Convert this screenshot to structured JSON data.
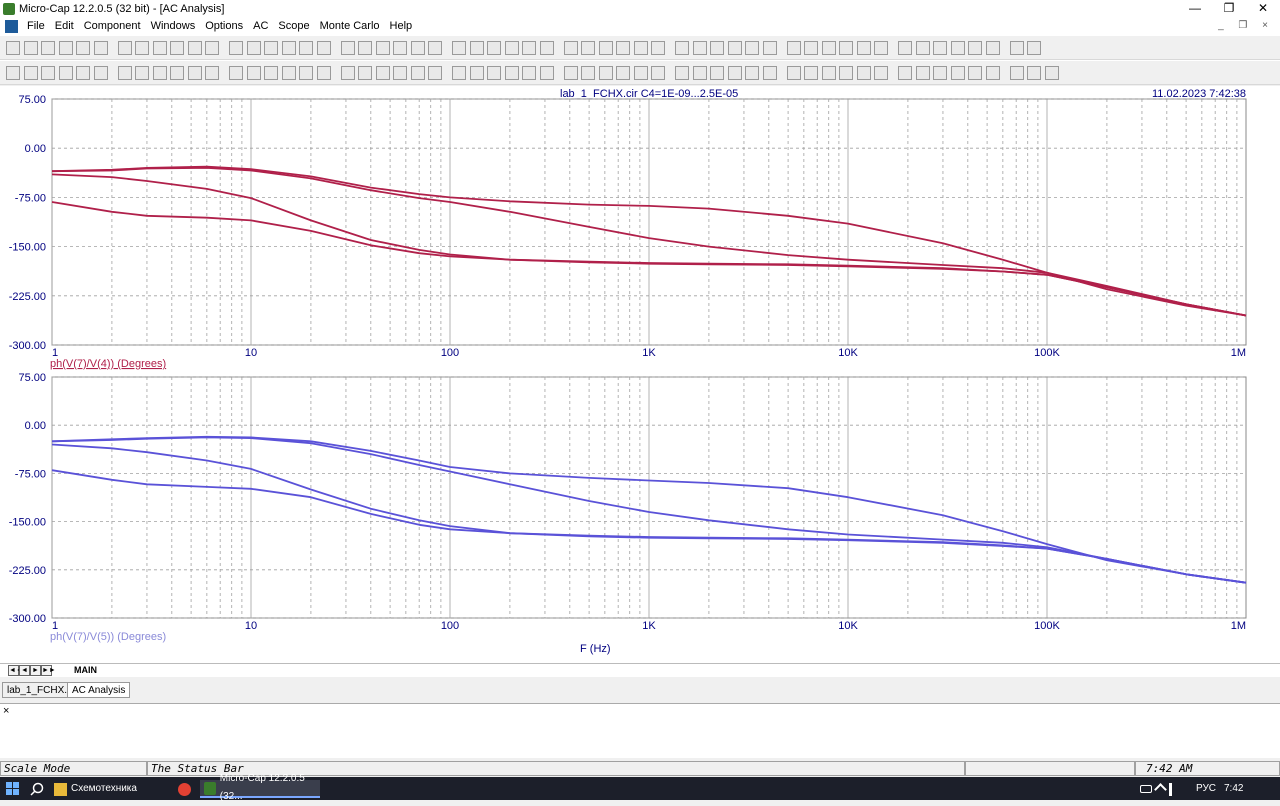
{
  "window": {
    "title": "Micro-Cap 12.2.0.5 (32 bit) - [AC Analysis]"
  },
  "menu": [
    "File",
    "Edit",
    "Component",
    "Windows",
    "Options",
    "AC",
    "Scope",
    "Monte Carlo",
    "Help"
  ],
  "plot": {
    "header": "lab_1_FCHX.cir C4=1E-09...2.5E-05",
    "timestamp": "11.02.2023 7:42:38",
    "x_label": "F (Hz)",
    "x_ticks": [
      "1",
      "10",
      "100",
      "1K",
      "10K",
      "100K",
      "1M"
    ],
    "y_ticks": [
      "75.00",
      "0.00",
      "-75.00",
      "-150.00",
      "-225.00",
      "-300.00"
    ],
    "colors": {
      "top": "#b0204a",
      "bottom": "#5a52d8",
      "grid": "#a0a0a0",
      "axis_text": "#000080"
    }
  },
  "chart_data": [
    {
      "type": "line",
      "scale_x": "log",
      "xlim": [
        1,
        1000000
      ],
      "ylim": [
        -300,
        75
      ],
      "ylabel": "ph(V(7)/V(4)) (Degrees)",
      "xlabel": "F (Hz)",
      "series": [
        {
          "x": [
            1,
            2,
            3,
            6,
            10,
            20,
            40,
            70,
            100,
            200,
            500,
            1000,
            2000,
            5000,
            10000,
            30000,
            60000,
            100000,
            200000,
            500000,
            1000000
          ],
          "values": [
            -35,
            -33,
            -30,
            -28,
            -32,
            -43,
            -60,
            -70,
            -75,
            -81,
            -86,
            -88,
            -92,
            -103,
            -115,
            -145,
            -170,
            -190,
            -215,
            -240,
            -255
          ]
        },
        {
          "x": [
            1,
            2,
            3,
            6,
            10,
            20,
            40,
            70,
            100,
            200,
            500,
            1000,
            2000,
            5000,
            10000,
            30000,
            60000,
            100000,
            200000,
            500000,
            1000000
          ],
          "values": [
            -35,
            -34,
            -31,
            -30,
            -34,
            -46,
            -64,
            -76,
            -82,
            -97,
            -120,
            -137,
            -150,
            -163,
            -170,
            -178,
            -183,
            -190,
            -210,
            -238,
            -255
          ]
        },
        {
          "x": [
            1,
            2,
            3,
            6,
            10,
            20,
            40,
            70,
            100,
            200,
            500,
            1000,
            2000,
            5000,
            10000,
            30000,
            60000,
            100000,
            200000,
            500000,
            1000000
          ],
          "values": [
            -40,
            -44,
            -50,
            -62,
            -76,
            -110,
            -140,
            -155,
            -162,
            -170,
            -174,
            -176,
            -177,
            -178,
            -180,
            -184,
            -188,
            -193,
            -212,
            -238,
            -255
          ]
        },
        {
          "x": [
            1,
            2,
            3,
            6,
            10,
            20,
            40,
            70,
            100,
            200,
            500,
            1000,
            2000,
            5000,
            10000,
            30000,
            60000,
            100000,
            200000,
            500000,
            1000000
          ],
          "values": [
            -82,
            -97,
            -103,
            -106,
            -110,
            -126,
            -148,
            -160,
            -165,
            -170,
            -173,
            -175,
            -176,
            -177,
            -179,
            -183,
            -188,
            -193,
            -212,
            -238,
            -255
          ]
        }
      ]
    },
    {
      "type": "line",
      "scale_x": "log",
      "xlim": [
        1,
        1000000
      ],
      "ylim": [
        -300,
        75
      ],
      "ylabel": "ph(V(7)/V(5)) (Degrees)",
      "xlabel": "F (Hz)",
      "series": [
        {
          "x": [
            1,
            2,
            3,
            6,
            10,
            20,
            40,
            70,
            100,
            200,
            500,
            1000,
            2000,
            5000,
            10000,
            30000,
            60000,
            100000,
            200000,
            500000,
            1000000
          ],
          "values": [
            -25,
            -22,
            -20,
            -18,
            -19,
            -25,
            -40,
            -55,
            -65,
            -75,
            -82,
            -86,
            -90,
            -98,
            -112,
            -140,
            -165,
            -185,
            -210,
            -232,
            -245
          ]
        },
        {
          "x": [
            1,
            2,
            3,
            6,
            10,
            20,
            40,
            70,
            100,
            200,
            500,
            1000,
            2000,
            5000,
            10000,
            30000,
            60000,
            100000,
            200000,
            500000,
            1000000
          ],
          "values": [
            -25,
            -23,
            -21,
            -19,
            -20,
            -28,
            -45,
            -62,
            -72,
            -92,
            -118,
            -135,
            -148,
            -162,
            -170,
            -178,
            -183,
            -190,
            -208,
            -232,
            -245
          ]
        },
        {
          "x": [
            1,
            2,
            3,
            6,
            10,
            20,
            40,
            70,
            100,
            200,
            500,
            1000,
            2000,
            5000,
            10000,
            30000,
            60000,
            100000,
            200000,
            500000,
            1000000
          ],
          "values": [
            -30,
            -36,
            -42,
            -55,
            -68,
            -100,
            -130,
            -148,
            -157,
            -168,
            -173,
            -175,
            -176,
            -177,
            -179,
            -183,
            -188,
            -192,
            -208,
            -232,
            -245
          ]
        },
        {
          "x": [
            1,
            2,
            3,
            6,
            10,
            20,
            40,
            70,
            100,
            200,
            500,
            1000,
            2000,
            5000,
            10000,
            30000,
            60000,
            100000,
            200000,
            500000,
            1000000
          ],
          "values": [
            -70,
            -85,
            -92,
            -96,
            -99,
            -112,
            -138,
            -155,
            -162,
            -168,
            -172,
            -174,
            -175,
            -176,
            -178,
            -182,
            -187,
            -192,
            -208,
            -232,
            -245
          ]
        }
      ]
    }
  ],
  "tabs": {
    "nav": [
      "◄◄",
      "◄",
      "►",
      "►►"
    ],
    "main": "MAIN"
  },
  "doc_tabs": [
    "lab_1_FCHX.cir",
    "AC Analysis"
  ],
  "log": {
    "close": "×"
  },
  "status": {
    "mode": "Scale Mode",
    "text": "The Status Bar",
    "time": "7:42 AM"
  },
  "taskbar": {
    "items": [
      "Схемотехника",
      "Micro-Cap 12.2.0.5 (32..."
    ],
    "lang": "РУС",
    "clock": "7:42"
  },
  "window_controls": [
    "—",
    "❐",
    "✕"
  ],
  "mdi_controls": "_ ❐ ×"
}
